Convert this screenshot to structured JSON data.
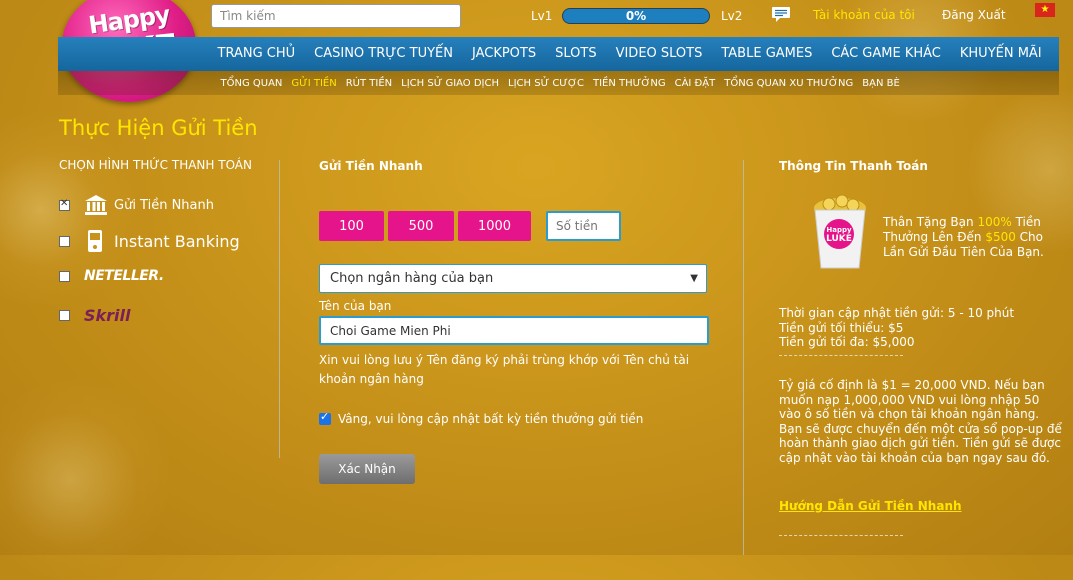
{
  "header": {
    "logo": {
      "line1": "Happy",
      "line2": "LUKE"
    },
    "search_placeholder": "Tìm kiếm",
    "level_from": "Lv1",
    "level_to": "Lv2",
    "progress_text": "0%",
    "progress_value": 0,
    "account_label": "Tài khoản của tôi",
    "logout_label": "Đăng Xuất",
    "flag_icon": "vietnam-flag-icon"
  },
  "nav": {
    "items": [
      "TRANG CHỦ",
      "CASINO TRỰC TUYẾN",
      "JACKPOTS",
      "SLOTS",
      "VIDEO SLOTS",
      "TABLE GAMES",
      "CÁC GAME KHÁC",
      "KHUYẾN MÃI"
    ]
  },
  "subnav": {
    "items": [
      "TỔNG QUAN",
      "GỬI TIỀN",
      "RÚT TIỀN",
      "LỊCH SỬ GIAO DỊCH",
      "LỊCH SỬ CƯỢC",
      "TIỀN THƯỞNG",
      "CÀI ĐẶT",
      "TỔNG QUAN XU THƯỞNG",
      "BẠN BÈ"
    ],
    "active_index": 1
  },
  "page": {
    "title": "Thực Hiện Gửi Tiền"
  },
  "payment_methods": {
    "heading": "CHỌN HÌNH THỨC THANH TOÁN",
    "items": [
      {
        "label": "Gửi Tiền Nhanh",
        "selected": true,
        "icon": "bank-icon"
      },
      {
        "label": "Instant Banking",
        "selected": false,
        "icon": "mobile-banking-icon"
      },
      {
        "label": "NETELLER.",
        "selected": false,
        "icon": "neteller-logo"
      },
      {
        "label": "Skrill",
        "selected": false,
        "icon": "skrill-logo"
      }
    ]
  },
  "deposit_form": {
    "heading": "Gửi Tiền Nhanh",
    "amounts": [
      "100",
      "500",
      "1000"
    ],
    "amount_placeholder": "Số tiền",
    "bank_select_value": "Chọn ngân hàng của bạn",
    "name_label": "Tên của bạn",
    "name_value": "Choi Game Mien Phi",
    "note": "Xin vui lòng lưu ý Tên đăng ký phải trùng khớp với Tên chủ tài khoản ngân hàng",
    "bonus_label": "Vâng, vui lòng cập nhật bất kỳ tiền thưởng gửi tiền",
    "bonus_checked": true,
    "submit_label": "Xác Nhận"
  },
  "payment_info": {
    "heading": "Thông Tin Thanh Toán",
    "promo": {
      "part1": "Thân Tặng Bạn ",
      "highlight1": "100%",
      "part2": " Tiền Thưởng Lên Đến ",
      "highlight2": "$500",
      "part3": " Cho Lần Gửi Đầu Tiên Của Bạn."
    },
    "update_time": "Thời gian cập nhật tiền gửi: 5 - 10 phút",
    "min_deposit": "Tiền gửi tối thiểu: $5",
    "max_deposit": "Tiền gửi tối đa: $5,000",
    "rate_text": "Tỷ giá cố định là $1 = 20,000 VND. Nếu bạn muốn nạp 1,000,000 VND vui lòng nhập 50 vào ô số tiền và chọn tài khoản ngân hàng. Bạn sẽ được chuyển đến một cửa sổ pop-up để hoàn thành giao dịch gửi tiền. Tiền gửi sẽ được cập nhật vào tài khoản của bạn ngay sau đó.",
    "guide_link": "Hướng Dẫn Gửi Tiền Nhanh",
    "promo_bucket_text": {
      "line1": "Happy",
      "line2": "LUKE"
    }
  },
  "colors": {
    "accent_yellow": "#ffe600",
    "nav_blue": "#1a6fa8",
    "pink": "#e6148a",
    "background": "#c8931a"
  }
}
